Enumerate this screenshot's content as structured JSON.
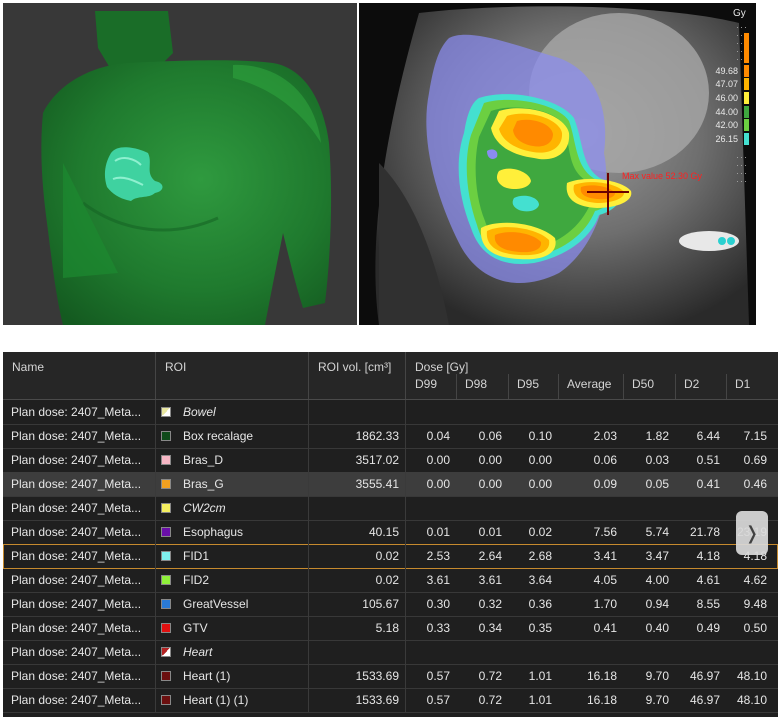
{
  "ct_view": {
    "unit": "Gy",
    "max_label": "Max value 52.30 Gy",
    "legend": [
      {
        "value": "49.68",
        "color": "#ff8a00"
      },
      {
        "value": "47.07",
        "color": "#ffb400"
      },
      {
        "value": "46.00",
        "color": "#ffef3a"
      },
      {
        "value": "44.00",
        "color": "#3fa83f"
      },
      {
        "value": "42.00",
        "color": "#6ccf41"
      },
      {
        "value": "26.15",
        "color": "#44e0d0"
      }
    ]
  },
  "table": {
    "columns": {
      "name": "Name",
      "roi": "ROI",
      "roi_vol": "ROI vol. [cm³]",
      "dose_group": "Dose [Gy]",
      "d99": "D99",
      "d98": "D98",
      "d95": "D95",
      "average": "Average",
      "d50": "D50",
      "d2": "D2",
      "d1": "D1"
    },
    "rows": [
      {
        "name": "Plan dose: 2407_Meta...",
        "roi": "Bowel",
        "color": "#e8e6a0",
        "icon": "struct",
        "italic": true,
        "vol": "",
        "d99": "",
        "d98": "",
        "d95": "",
        "avg": "",
        "d50": "",
        "d2": "",
        "d1": ""
      },
      {
        "name": "Plan dose: 2407_Meta...",
        "roi": "Box recalage",
        "color": "#0f4a1a",
        "vol": "1862.33",
        "d99": "0.04",
        "d98": "0.06",
        "d95": "0.10",
        "avg": "2.03",
        "d50": "1.82",
        "d2": "6.44",
        "d1": "7.15"
      },
      {
        "name": "Plan dose: 2407_Meta...",
        "roi": "Bras_D",
        "color": "#f6b6c4",
        "vol": "3517.02",
        "d99": "0.00",
        "d98": "0.00",
        "d95": "0.00",
        "avg": "0.06",
        "d50": "0.03",
        "d2": "0.51",
        "d1": "0.69"
      },
      {
        "name": "Plan dose: 2407_Meta...",
        "roi": "Bras_G",
        "color": "#f1a020",
        "vol": "3555.41",
        "d99": "0.00",
        "d98": "0.00",
        "d95": "0.00",
        "avg": "0.09",
        "d50": "0.05",
        "d2": "0.41",
        "d1": "0.46"
      },
      {
        "name": "Plan dose: 2407_Meta...",
        "roi": "CW2cm",
        "color": "#f5ef60",
        "italic": true,
        "vol": "",
        "d99": "",
        "d98": "",
        "d95": "",
        "avg": "",
        "d50": "",
        "d2": "",
        "d1": ""
      },
      {
        "name": "Plan dose: 2407_Meta...",
        "roi": "Esophagus",
        "color": "#6a0fa8",
        "vol": "40.15",
        "d99": "0.01",
        "d98": "0.01",
        "d95": "0.02",
        "avg": "7.56",
        "d50": "5.74",
        "d2": "21.78",
        "d1": "23.19"
      },
      {
        "name": "Plan dose: 2407_Meta...",
        "roi": "FID1",
        "color": "#7ff0ee",
        "vol": "0.02",
        "d99": "2.53",
        "d98": "2.64",
        "d95": "2.68",
        "avg": "3.41",
        "d50": "3.47",
        "d2": "4.18",
        "d1": "4.18"
      },
      {
        "name": "Plan dose: 2407_Meta...",
        "roi": "FID2",
        "color": "#8ff03a",
        "vol": "0.02",
        "d99": "3.61",
        "d98": "3.61",
        "d95": "3.64",
        "avg": "4.05",
        "d50": "4.00",
        "d2": "4.61",
        "d1": "4.62"
      },
      {
        "name": "Plan dose: 2407_Meta...",
        "roi": "GreatVessel",
        "color": "#2a7ad6",
        "vol": "105.67",
        "d99": "0.30",
        "d98": "0.32",
        "d95": "0.36",
        "avg": "1.70",
        "d50": "0.94",
        "d2": "8.55",
        "d1": "9.48"
      },
      {
        "name": "Plan dose: 2407_Meta...",
        "roi": "GTV",
        "color": "#e01010",
        "vol": "5.18",
        "d99": "0.33",
        "d98": "0.34",
        "d95": "0.35",
        "avg": "0.41",
        "d50": "0.40",
        "d2": "0.49",
        "d1": "0.50"
      },
      {
        "name": "Plan dose: 2407_Meta...",
        "roi": "Heart",
        "color": "#b22222",
        "icon": "struct",
        "italic": true,
        "vol": "",
        "d99": "",
        "d98": "",
        "d95": "",
        "avg": "",
        "d50": "",
        "d2": "",
        "d1": ""
      },
      {
        "name": "Plan dose: 2407_Meta...",
        "roi": "Heart (1)",
        "color": "#6b0f0f",
        "vol": "1533.69",
        "d99": "0.57",
        "d98": "0.72",
        "d95": "1.01",
        "avg": "16.18",
        "d50": "9.70",
        "d2": "46.97",
        "d1": "48.10"
      },
      {
        "name": "Plan dose: 2407_Meta...",
        "roi": "Heart (1) (1)",
        "color": "#6b0f0f",
        "vol": "1533.69",
        "d99": "0.57",
        "d98": "0.72",
        "d95": "1.01",
        "avg": "16.18",
        "d50": "9.70",
        "d2": "46.97",
        "d1": "48.10"
      }
    ],
    "selected_row_index": 3,
    "highlighted_row_index": 6,
    "scroll_icon": "chevron-right-icon"
  }
}
